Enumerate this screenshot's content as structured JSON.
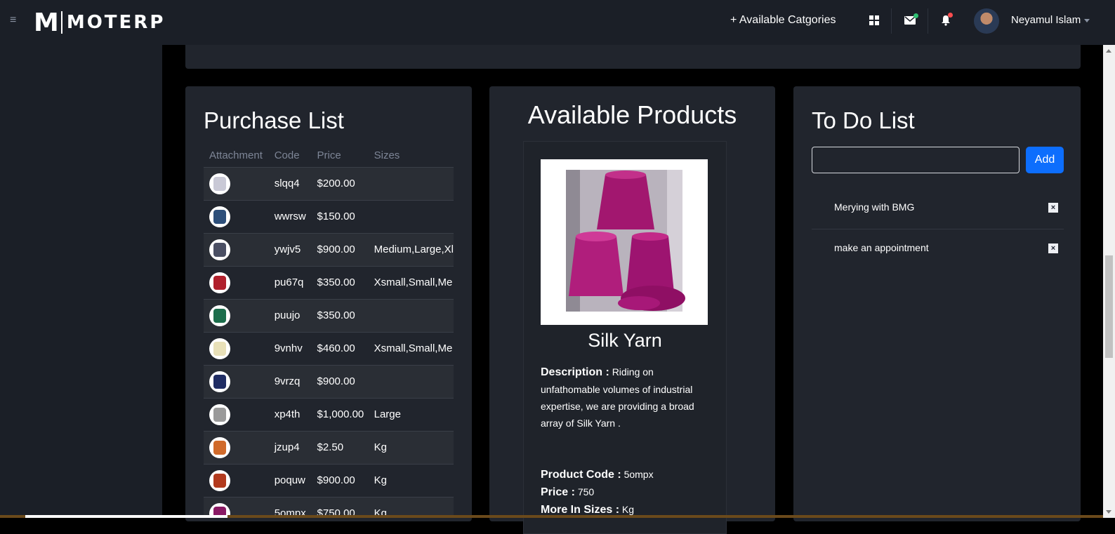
{
  "header": {
    "logo_mark": "M",
    "logo_text": "MOTERP",
    "categories_link": "+ Available Catgories",
    "user_name": "Neyamul Islam"
  },
  "purchase_list": {
    "title": "Purchase List",
    "columns": [
      "Attachment",
      "Code",
      "Price",
      "Sizes"
    ],
    "rows": [
      {
        "code": "slqq4",
        "price": "$200.00",
        "sizes": ""
      },
      {
        "code": "wwrsw",
        "price": "$150.00",
        "sizes": ""
      },
      {
        "code": "ywjv5",
        "price": "$900.00",
        "sizes": "Medium,Large,Xl"
      },
      {
        "code": "pu67q",
        "price": "$350.00",
        "sizes": "Xsmall,Small,Me"
      },
      {
        "code": "puujo",
        "price": "$350.00",
        "sizes": ""
      },
      {
        "code": "9vnhv",
        "price": "$460.00",
        "sizes": "Xsmall,Small,Me"
      },
      {
        "code": "9vrzq",
        "price": "$900.00",
        "sizes": ""
      },
      {
        "code": "xp4th",
        "price": "$1,000.00",
        "sizes": "Large"
      },
      {
        "code": "jzup4",
        "price": "$2.50",
        "sizes": "Kg"
      },
      {
        "code": "poquw",
        "price": "$900.00",
        "sizes": "Kg"
      },
      {
        "code": "5ompx",
        "price": "$750.00",
        "sizes": "Kg"
      }
    ]
  },
  "available_products": {
    "title": "Available Products",
    "product": {
      "name": "Silk Yarn",
      "description_label": "Description :",
      "description": "Riding on unfathomable volumes of industrial expertise, we are providing a broad array of Silk Yarn .",
      "code_label": "Product Code :",
      "code": "5ompx",
      "price_label": "Price :",
      "price": "750",
      "sizes_label": "More In Sizes :",
      "sizes": "Kg"
    }
  },
  "todo": {
    "title": "To Do List",
    "input_value": "",
    "add_label": "Add",
    "items": [
      {
        "label": "Merying with BMG"
      },
      {
        "label": "make an appointment"
      }
    ]
  },
  "colors": {
    "accent": "#0d6efd",
    "panel": "#21252d",
    "topbar": "#1b1f27",
    "mail_dot": "#2fbf71",
    "bell_dot": "#ff4d4f"
  }
}
